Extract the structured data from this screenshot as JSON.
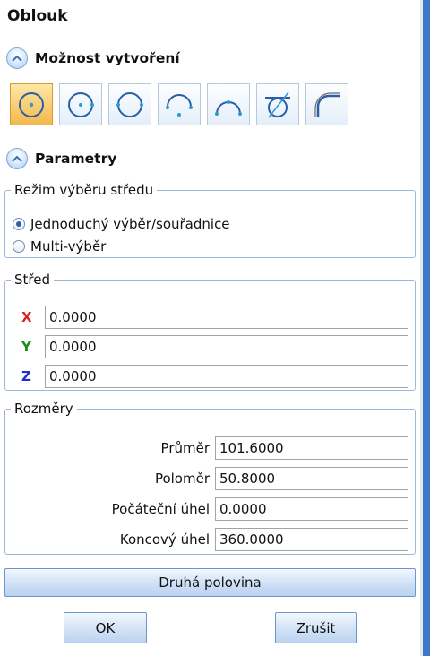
{
  "title": "Oblouk",
  "creation": {
    "heading": "Možnost vytvoření",
    "tools": [
      {
        "icon": "arc-center-point-icon",
        "active": true
      },
      {
        "icon": "arc-center-radius-icon",
        "active": false
      },
      {
        "icon": "arc-two-points-icon",
        "active": false
      },
      {
        "icon": "arc-three-points-icon",
        "active": false
      },
      {
        "icon": "arc-start-end-icon",
        "active": false
      },
      {
        "icon": "arc-tangent-icon",
        "active": false
      },
      {
        "icon": "arc-fillet-icon",
        "active": false
      }
    ]
  },
  "params": {
    "heading": "Parametry",
    "center_mode": {
      "legend": "Režim výběru středu",
      "options": [
        "Jednoduchý výběr/souřadnice",
        "Multi-výběr"
      ],
      "selected": 0
    },
    "center": {
      "legend": "Střed",
      "x_label": "X",
      "x_value": "0.0000",
      "x_color": "#e02020",
      "y_label": "Y",
      "y_value": "0.0000",
      "y_color": "#1e8a1e",
      "z_label": "Z",
      "z_value": "0.0000",
      "z_color": "#1f2fd6"
    },
    "dimensions": {
      "legend": "Rozměry",
      "diameter_label": "Průměr",
      "diameter_value": "101.6000",
      "radius_label": "Poloměr",
      "radius_value": "50.8000",
      "start_angle_label": "Počáteční úhel",
      "start_angle_value": "0.0000",
      "end_angle_label": "Koncový úhel",
      "end_angle_value": "360.0000"
    }
  },
  "buttons": {
    "second_half": "Druhá polovina",
    "ok": "OK",
    "cancel": "Zrušit"
  }
}
